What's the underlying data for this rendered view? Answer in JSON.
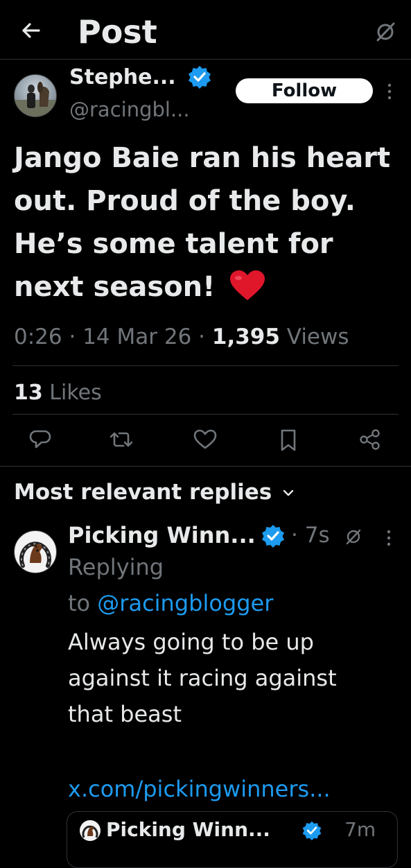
{
  "header": {
    "title": "Post",
    "back_icon": "arrow-left-icon",
    "status_icon": "no-circle-icon"
  },
  "post": {
    "author_name": "Stephe...",
    "handle": "@racingbl...",
    "follow_label": "Follow",
    "text_lines": [
      "Jango Baie ran his heart",
      "out. Proud of the boy.",
      "He’s some talent for",
      "next season!"
    ],
    "emoji": "❤️",
    "meta": {
      "time": "0:26",
      "sep1": "·",
      "date": "14 Mar 26",
      "sep2": "·",
      "views_count": "1,395",
      "views_label": "Views"
    },
    "likes_count": "13",
    "likes_label": "Likes"
  },
  "replies": {
    "sort_label": "Most relevant replies",
    "items": [
      {
        "author_name": "Picking Winn...",
        "dot": "·",
        "time": "7s",
        "replying_label": "Replying",
        "to_label": "to",
        "to_handle": "@racingblogger",
        "text_lines": [
          "Always going to be up",
          "against it racing against",
          "that beast"
        ],
        "link": "x.com/pickingwinners...",
        "quoted_author": "Picking Winn...",
        "quoted_time": "7m"
      }
    ]
  },
  "colors": {
    "background": "#000000",
    "text": "#e7e9ea",
    "muted": "#71767b",
    "accent": "#1d9bf0",
    "divider": "#2f3336",
    "heart": "#e0162b"
  }
}
